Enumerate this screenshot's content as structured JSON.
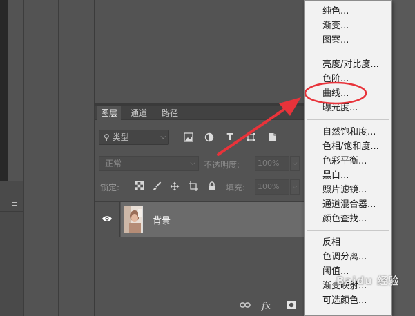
{
  "layers_panel": {
    "tabs": [
      "图层",
      "通道",
      "路径"
    ],
    "filter": {
      "kind_label": "类型"
    },
    "blend": {
      "mode": "正常",
      "opacity_label": "不透明度:",
      "opacity_value": "100%"
    },
    "lock": {
      "label": "锁定:",
      "fill_label": "填充:",
      "fill_value": "100%"
    },
    "layer": {
      "name": "背景",
      "visible": true
    },
    "footer_icons": [
      "link-icon",
      "fx-icon",
      "mask-icon"
    ]
  },
  "menu": {
    "groups": [
      [
        "纯色...",
        "渐变...",
        "图案..."
      ],
      [
        "亮度/对比度...",
        "色阶...",
        "曲线...",
        "曝光度..."
      ],
      [
        "自然饱和度...",
        "色相/饱和度...",
        "色彩平衡...",
        "黑白...",
        "照片滤镜...",
        "通道混合器...",
        "颜色查找..."
      ],
      [
        "反相",
        "色调分离...",
        "阈值...",
        "渐变映射...",
        "可选颜色..."
      ]
    ],
    "highlighted": "曲线..."
  },
  "colors": {
    "annotation": "#e8333a",
    "menu_bg": "#f2f2f2",
    "panel_bg": "#535353"
  },
  "watermark": "Baidu 经验"
}
